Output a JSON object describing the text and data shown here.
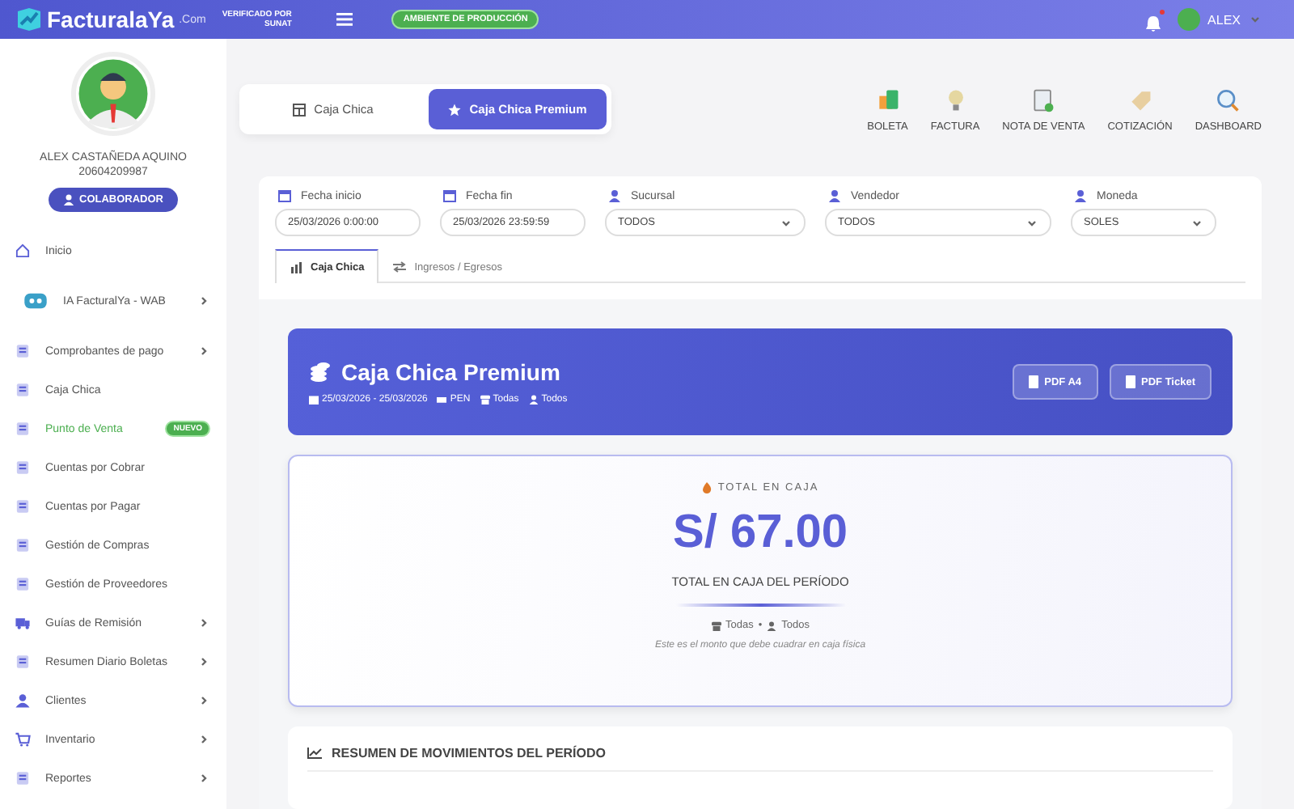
{
  "header": {
    "logo_text": "FacturalaYa",
    "logo_suffix": ".Com",
    "verified_line1": "VERIFICADO POR",
    "verified_line2": "SUNAT",
    "environment_badge": "AMBIENTE DE PRODUCCIÓN",
    "notifications_unread": true,
    "user": "ALEX"
  },
  "sidebar": {
    "profile": {
      "name": "ALEX CASTAÑEDA AQUINO",
      "ruc": "20604209987",
      "role_button": "COLABORADOR"
    },
    "items": [
      {
        "label": "Inicio",
        "selected": false,
        "expandable": false
      },
      {
        "label": "IA FacturalYa - WAB",
        "selected": false,
        "expandable": true
      },
      {
        "label": "Comprobantes de pago",
        "selected": false,
        "expandable": true
      },
      {
        "label": "Caja Chica",
        "selected": false,
        "expandable": false
      },
      {
        "label": "Punto de Venta",
        "selected": true,
        "expandable": false,
        "badge": "NUEVO"
      },
      {
        "label": "Cuentas por Cobrar",
        "selected": false,
        "expandable": false
      },
      {
        "label": "Cuentas por Pagar",
        "selected": false,
        "expandable": false
      },
      {
        "label": "Gestión de Compras",
        "selected": false,
        "expandable": false
      },
      {
        "label": "Gestión de Proveedores",
        "selected": false,
        "expandable": false
      },
      {
        "label": "Guías de Remisión",
        "selected": false,
        "expandable": true
      },
      {
        "label": "Resumen Diario Boletas",
        "selected": false,
        "expandable": true
      },
      {
        "label": "Clientes",
        "selected": false,
        "expandable": true
      },
      {
        "label": "Inventario",
        "selected": false,
        "expandable": true
      },
      {
        "label": "Reportes",
        "selected": false,
        "expandable": true
      }
    ]
  },
  "mode_tabs": [
    {
      "label": "Caja Chica",
      "selected": false
    },
    {
      "label": "Caja Chica Premium",
      "selected": true
    }
  ],
  "quick_actions": [
    "BOLETA",
    "FACTURA",
    "NOTA DE VENTA",
    "COTIZACIÓN",
    "DASHBOARD"
  ],
  "filters": [
    {
      "label": "Fecha inicio",
      "kind": "date",
      "value": "25/03/2026 0:00:00"
    },
    {
      "label": "Fecha fin",
      "kind": "date",
      "value": "25/03/2026 23:59:59"
    },
    {
      "label": "Sucursal",
      "kind": "select",
      "value": "TODOS"
    },
    {
      "label": "Vendedor",
      "kind": "select",
      "value": "TODOS"
    },
    {
      "label": "Moneda",
      "kind": "select",
      "value": "SOLES"
    }
  ],
  "view_tabs": [
    {
      "label": "Caja Chica",
      "selected": true
    },
    {
      "label": "Ingresos / Egresos",
      "selected": false
    }
  ],
  "banner": {
    "title": "Caja Chica Premium",
    "period": "25/03/2026 - 25/03/2026",
    "currency": "PEN",
    "branch": "Todas",
    "seller": "Todos",
    "buttons": [
      "PDF A4",
      "PDF Ticket"
    ]
  },
  "total_card": {
    "label": "TOTAL EN CAJA",
    "amount": "S/ 67.00",
    "subtitle": "TOTAL EN CAJA DEL PERÍODO",
    "branch": "Todas",
    "separator": "•",
    "seller": "Todos",
    "note": "Este es el monto que debe cuadrar en caja física"
  },
  "summary": {
    "title": "RESUMEN DE MOVIMIENTOS DEL PERÍODO"
  }
}
